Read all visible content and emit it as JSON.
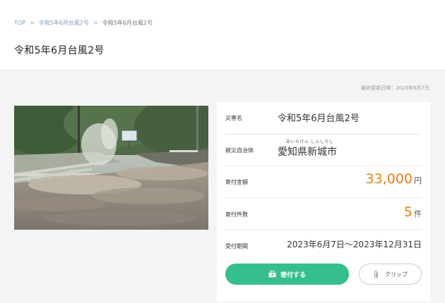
{
  "breadcrumb": {
    "items": [
      {
        "label": "TOP"
      },
      {
        "label": "令和5年6月台風2号"
      },
      {
        "label": "令和5年6月台風2号"
      }
    ],
    "separator": ">"
  },
  "page_title": "令和5年6月台風2号",
  "updated": "最終更新日時：2023年6月7日",
  "photo": {
    "icon": "flood-photo"
  },
  "details": {
    "disaster_name": {
      "label": "災害名",
      "value": "令和5年6月台風2号"
    },
    "municipality": {
      "label": "被災自治体",
      "ruby": "あいちけん しんしろし",
      "value": "愛知県新城市"
    },
    "amount": {
      "label": "寄付金額",
      "value": "33,000",
      "unit": "円"
    },
    "count": {
      "label": "寄付件数",
      "value": "5",
      "unit": "件"
    },
    "period": {
      "label": "受付期間",
      "value": "2023年6月7日〜2023年12月31日"
    }
  },
  "actions": {
    "donate_label": "寄付する",
    "clip_label": "クリップ"
  },
  "colors": {
    "accent": "#35bf8c",
    "amount": "#e8800c",
    "link": "#7e9fbf"
  }
}
